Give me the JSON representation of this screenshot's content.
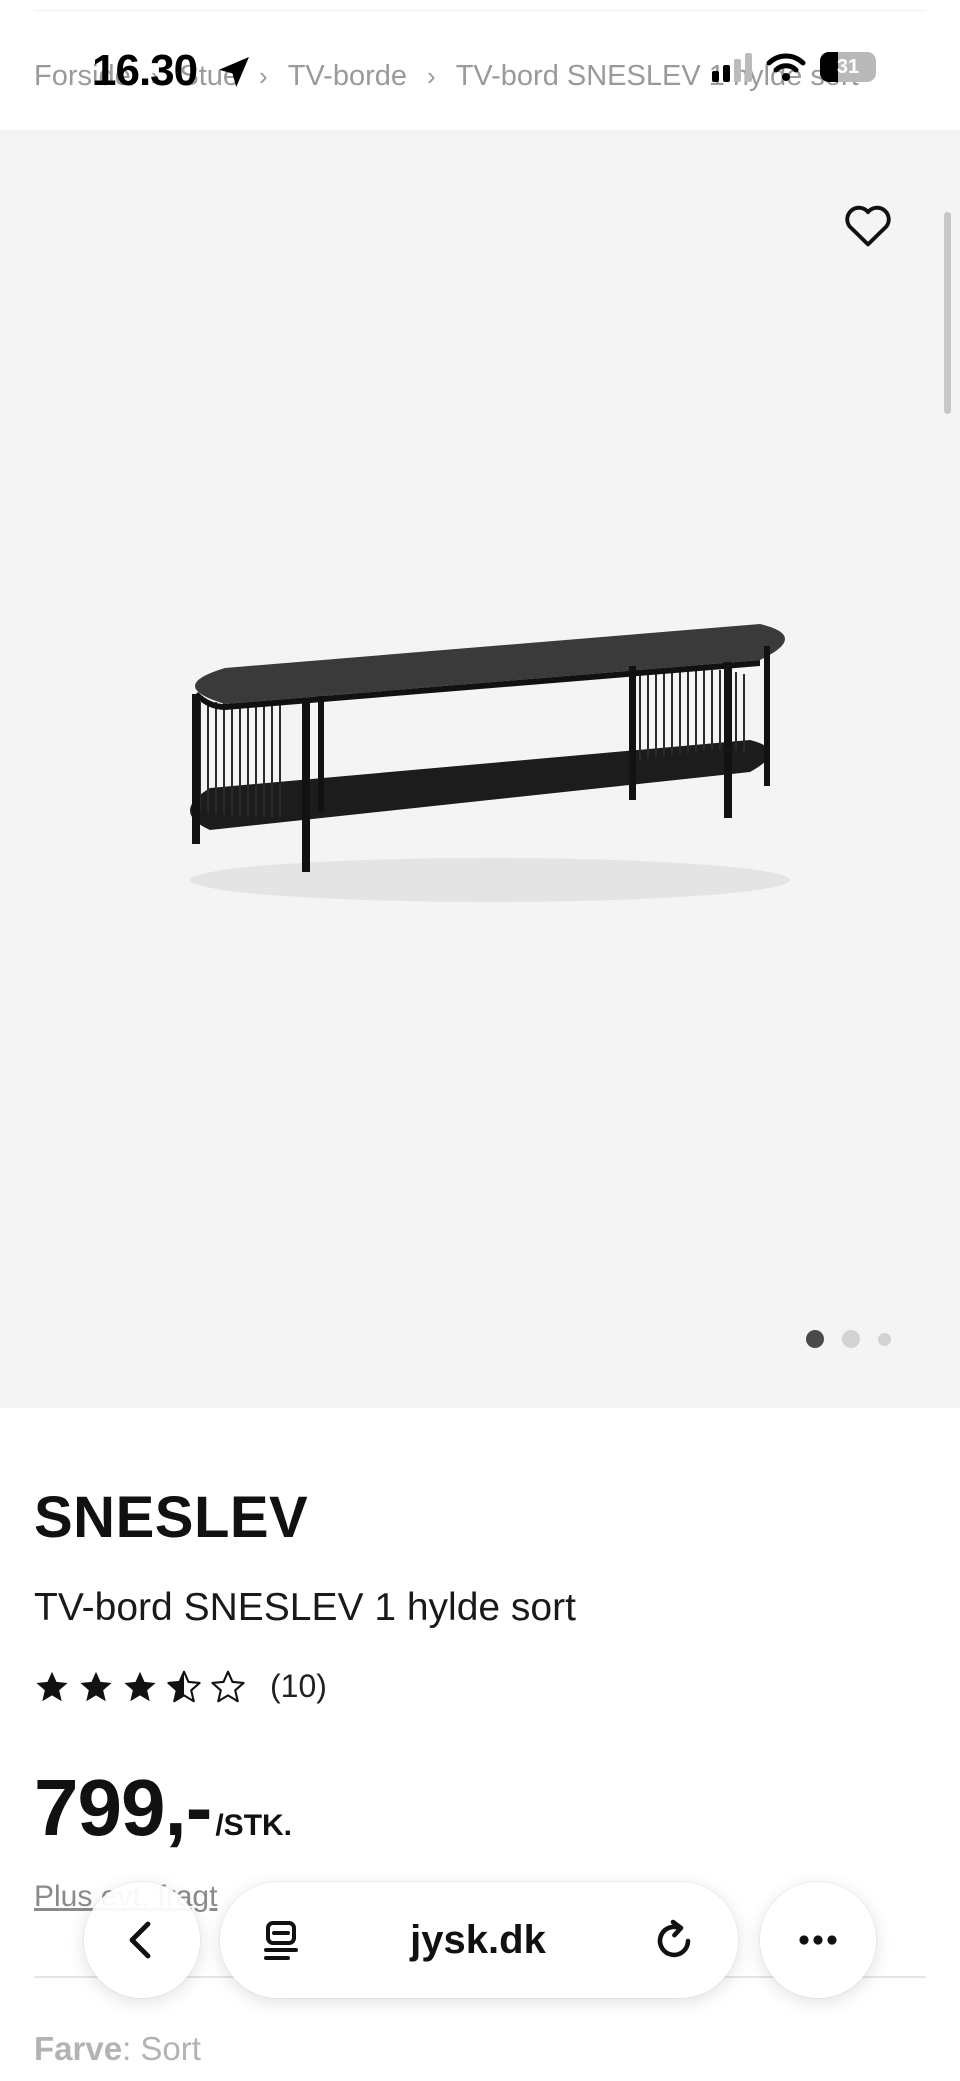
{
  "status_bar": {
    "time": "16.30",
    "battery": "31"
  },
  "breadcrumb": [
    "Forside",
    "Stue",
    "TV-borde",
    "TV-bord SNESLEV 1 hylde sort"
  ],
  "breadcrumb_separator": "›",
  "gallery": {
    "image_count": 3,
    "active_index": 0
  },
  "product": {
    "brand": "SNESLEV",
    "title": "TV-bord SNESLEV 1 hylde sort",
    "rating": 3.5,
    "review_count": "(10)",
    "price": "799,-",
    "price_unit": "/STK.",
    "plus_text": "Plus evt. fragt",
    "color_label": "Farve",
    "color_value": ": Sort"
  },
  "browser": {
    "url": "jysk.dk"
  },
  "colors": {
    "accent": "#111111",
    "muted": "#9a9a9a",
    "image_bg": "#f4f4f4"
  },
  "icons": [
    "location-arrow-icon",
    "signal-icon",
    "wifi-icon",
    "battery-icon",
    "heart-icon",
    "star-icon",
    "back-chevron-icon",
    "reader-icon",
    "reload-icon",
    "more-icon"
  ]
}
